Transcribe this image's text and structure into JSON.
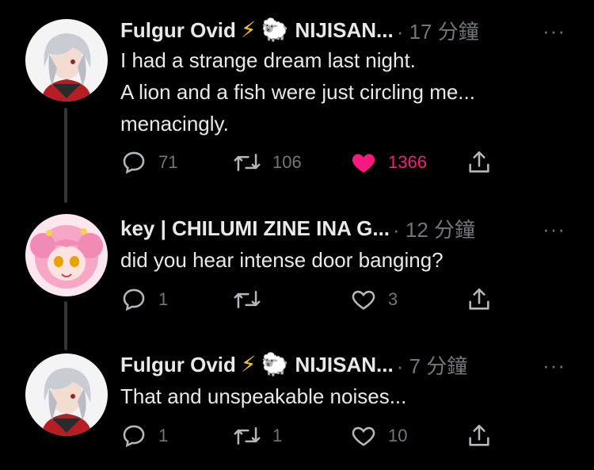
{
  "thread": [
    {
      "author": "Fulgur Ovid",
      "emoji1": "⚡",
      "emoji2": "🐑",
      "name_suffix": "NIJISAN...",
      "time": "· 17 分鐘",
      "more": "···",
      "text": "I had a strange dream last night.\nA lion and a fish were just circling me...\nmenacingly.",
      "replies": "71",
      "retweets": "106",
      "likes": "1366",
      "liked": true
    },
    {
      "author": "key | CHILUMI ZINE INA G...",
      "time": "· 12 分鐘",
      "more": "···",
      "text": "did you hear intense door banging?",
      "replies": "1",
      "retweets": "",
      "likes": "3",
      "liked": false
    },
    {
      "author": "Fulgur Ovid",
      "emoji1": "⚡",
      "emoji2": "🐑",
      "name_suffix": "NIJISAN...",
      "time": "· 7 分鐘",
      "more": "···",
      "text": "That and unspeakable noises...",
      "replies": "1",
      "retweets": "1",
      "likes": "10",
      "liked": false
    }
  ],
  "colors": {
    "like_active": "#f91880",
    "muted": "#71767b",
    "text": "#e7e9ea",
    "thread_line": "#333639"
  },
  "icons": {
    "reply": "reply-icon",
    "retweet": "retweet-icon",
    "like": "heart-icon",
    "share": "share-icon"
  }
}
